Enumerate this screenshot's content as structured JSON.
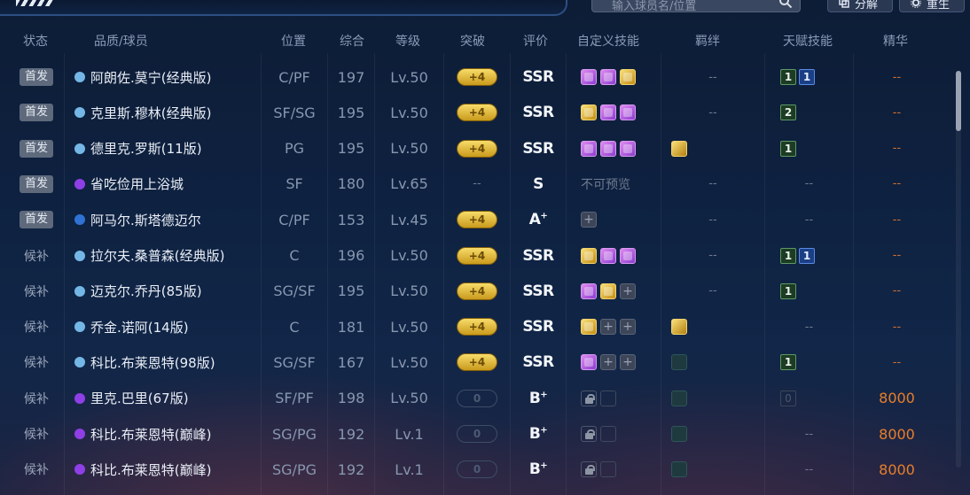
{
  "toolbar": {
    "search_placeholder": "输入球员名/位置",
    "decompose_label": "分解",
    "reset_label": "重生"
  },
  "columns": {
    "status": "状态",
    "player": "品质/球员",
    "position": "位置",
    "overall": "综合",
    "level": "等级",
    "breakthrough": "突破",
    "rating": "评价",
    "custom_skills": "自定义技能",
    "bonds": "羁绊",
    "talents": "天赋技能",
    "essence": "精华"
  },
  "colors": {
    "quality_blue": "#74b7e6",
    "quality_purple": "#8f3fe6",
    "quality_darkblue": "#2f72d3",
    "essence_orange": "#e87f2a"
  },
  "rows": [
    {
      "status": "首发",
      "status_badge": true,
      "quality": "blue",
      "name": "阿朗佐.莫宁(经典版)",
      "position": "C/PF",
      "overall": "197",
      "level": "Lv.50",
      "breakthrough": "+4",
      "rating": "SSR",
      "rating_sup": "",
      "skills": [
        "purple",
        "purple",
        "gold"
      ],
      "skills_text": "",
      "bonds": [],
      "bonds_text": "--",
      "talents": [
        {
          "v": "1",
          "c": "green"
        },
        {
          "v": "1",
          "c": "blue"
        }
      ],
      "talents_text": "",
      "essence": "--"
    },
    {
      "status": "首发",
      "status_badge": true,
      "quality": "blue",
      "name": "克里斯.穆林(经典版)",
      "position": "SF/SG",
      "overall": "195",
      "level": "Lv.50",
      "breakthrough": "+4",
      "rating": "SSR",
      "rating_sup": "",
      "skills": [
        "gold",
        "purple",
        "purple"
      ],
      "skills_text": "",
      "bonds": [],
      "bonds_text": "--",
      "talents": [
        {
          "v": "2",
          "c": "green"
        }
      ],
      "talents_text": "",
      "essence": "--"
    },
    {
      "status": "首发",
      "status_badge": true,
      "quality": "blue",
      "name": "德里克.罗斯(11版)",
      "position": "PG",
      "overall": "195",
      "level": "Lv.50",
      "breakthrough": "+4",
      "rating": "SSR",
      "rating_sup": "",
      "skills": [
        "purple",
        "purple",
        "purple"
      ],
      "skills_text": "",
      "bonds": [
        "gold"
      ],
      "bonds_text": "",
      "talents": [
        {
          "v": "1",
          "c": "green"
        }
      ],
      "talents_text": "",
      "essence": "--"
    },
    {
      "status": "首发",
      "status_badge": true,
      "quality": "purple",
      "name": "省吃俭用上浴城",
      "position": "SF",
      "overall": "180",
      "level": "Lv.65",
      "breakthrough": "--",
      "rating": "S",
      "rating_sup": "",
      "skills": [],
      "skills_text": "不可预览",
      "bonds": [],
      "bonds_text": "--",
      "talents": [],
      "talents_text": "--",
      "essence": "--"
    },
    {
      "status": "首发",
      "status_badge": true,
      "quality": "darkblue",
      "name": "阿马尔.斯塔德迈尔",
      "position": "C/PF",
      "overall": "153",
      "level": "Lv.45",
      "breakthrough": "+4",
      "rating": "A",
      "rating_sup": "+",
      "skills": [
        "empty"
      ],
      "skills_text": "",
      "bonds": [],
      "bonds_text": "--",
      "talents": [],
      "talents_text": "--",
      "essence": "--"
    },
    {
      "status": "候补",
      "status_badge": false,
      "quality": "blue",
      "name": "拉尔夫.桑普森(经典版)",
      "position": "C",
      "overall": "196",
      "level": "Lv.50",
      "breakthrough": "+4",
      "rating": "SSR",
      "rating_sup": "",
      "skills": [
        "gold",
        "purple",
        "purple"
      ],
      "skills_text": "",
      "bonds": [],
      "bonds_text": "--",
      "talents": [
        {
          "v": "1",
          "c": "green"
        },
        {
          "v": "1",
          "c": "blue"
        }
      ],
      "talents_text": "",
      "essence": "--"
    },
    {
      "status": "候补",
      "status_badge": false,
      "quality": "blue",
      "name": "迈克尔.乔丹(85版)",
      "position": "SG/SF",
      "overall": "195",
      "level": "Lv.50",
      "breakthrough": "+4",
      "rating": "SSR",
      "rating_sup": "",
      "skills": [
        "purple",
        "gold",
        "empty"
      ],
      "skills_text": "",
      "bonds": [],
      "bonds_text": "--",
      "talents": [
        {
          "v": "1",
          "c": "green"
        }
      ],
      "talents_text": "",
      "essence": "--"
    },
    {
      "status": "候补",
      "status_badge": false,
      "quality": "blue",
      "name": "乔金.诺阿(14版)",
      "position": "C",
      "overall": "181",
      "level": "Lv.50",
      "breakthrough": "+4",
      "rating": "SSR",
      "rating_sup": "",
      "skills": [
        "gold",
        "empty",
        "empty"
      ],
      "skills_text": "",
      "bonds": [
        "gold"
      ],
      "bonds_text": "",
      "talents": [],
      "talents_text": "--",
      "essence": "--"
    },
    {
      "status": "候补",
      "status_badge": false,
      "quality": "blue",
      "name": "科比.布莱恩特(98版)",
      "position": "SG/SF",
      "overall": "167",
      "level": "Lv.50",
      "breakthrough": "+4",
      "rating": "SSR",
      "rating_sup": "",
      "skills": [
        "purple",
        "empty",
        "empty"
      ],
      "skills_text": "",
      "bonds": [
        "faded"
      ],
      "bonds_text": "",
      "talents": [
        {
          "v": "1",
          "c": "green"
        }
      ],
      "talents_text": "",
      "essence": "--"
    },
    {
      "status": "候补",
      "status_badge": false,
      "quality": "purple",
      "name": "里克.巴里(67版)",
      "position": "SF/PF",
      "overall": "198",
      "level": "Lv.50",
      "breakthrough": "0",
      "rating": "B",
      "rating_sup": "+",
      "skills": [
        "lock",
        "hollow"
      ],
      "skills_text": "",
      "bonds": [
        "faded"
      ],
      "bonds_text": "",
      "talents": [
        {
          "v": "0",
          "c": "faded"
        }
      ],
      "talents_text": "",
      "essence": "8000"
    },
    {
      "status": "候补",
      "status_badge": false,
      "quality": "purple",
      "name": "科比.布莱恩特(巅峰)",
      "position": "SG/PG",
      "overall": "192",
      "level": "Lv.1",
      "breakthrough": "0",
      "rating": "B",
      "rating_sup": "+",
      "skills": [
        "lock",
        "hollow"
      ],
      "skills_text": "",
      "bonds": [
        "faded"
      ],
      "bonds_text": "",
      "talents": [],
      "talents_text": "--",
      "essence": "8000"
    },
    {
      "status": "候补",
      "status_badge": false,
      "quality": "purple",
      "name": "科比.布莱恩特(巅峰)",
      "position": "SG/PG",
      "overall": "192",
      "level": "Lv.1",
      "breakthrough": "0",
      "rating": "B",
      "rating_sup": "+",
      "skills": [
        "lock",
        "hollow"
      ],
      "skills_text": "",
      "bonds": [
        "faded"
      ],
      "bonds_text": "",
      "talents": [],
      "talents_text": "--",
      "essence": "8000"
    }
  ]
}
